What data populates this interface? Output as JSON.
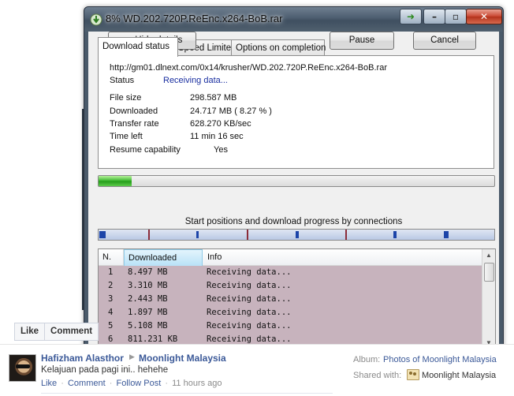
{
  "window": {
    "title": "8% WD.202.720P.ReEnc.x264-BoB.rar",
    "tabs": [
      "Download status",
      "Speed Limiter",
      "Options on completion"
    ],
    "url": "http://gm01.dlnext.com/0x14/krusher/WD.202.720P.ReEnc.x264-BoB.rar",
    "status_label": "Status",
    "status_value": "Receiving data...",
    "fields": [
      {
        "label": "File size",
        "value": "298.587  MB"
      },
      {
        "label": "Downloaded",
        "value": "24.717  MB  ( 8.27 % )"
      },
      {
        "label": "Transfer rate",
        "value": "628.270  KB/sec"
      },
      {
        "label": "Time left",
        "value": "11 min 16 sec"
      },
      {
        "label": "Resume capability",
        "value": "Yes"
      }
    ],
    "progress_percent": 8.27,
    "buttons": {
      "hide": "<< Hide details",
      "pause": "Pause",
      "cancel": "Cancel"
    },
    "connections_label": "Start positions and download progress by connections",
    "list": {
      "columns": [
        "N.",
        "Downloaded",
        "Info"
      ],
      "rows": [
        {
          "n": "1",
          "downloaded": "8.497  MB",
          "info": "Receiving data..."
        },
        {
          "n": "2",
          "downloaded": "3.310  MB",
          "info": "Receiving data..."
        },
        {
          "n": "3",
          "downloaded": "2.443  MB",
          "info": "Receiving data..."
        },
        {
          "n": "4",
          "downloaded": "1.897  MB",
          "info": "Receiving data..."
        },
        {
          "n": "5",
          "downloaded": "5.108  MB",
          "info": "Receiving data..."
        },
        {
          "n": "6",
          "downloaded": "811.231  KB",
          "info": "Receiving data..."
        }
      ]
    }
  },
  "facebook": {
    "actions": [
      "Like",
      "Comment"
    ],
    "author": "Hafizham Alasthor",
    "page": "Moonlight Malaysia",
    "message": "Kelajuan pada pagi ini.. hehehe",
    "links": [
      "Like",
      "Comment",
      "Follow Post"
    ],
    "time": "11 hours ago",
    "album_label": "Album:",
    "album_value": "Photos of Moonlight Malaysia",
    "shared_label": "Shared with:",
    "shared_value": "Moonlight Malaysia"
  }
}
